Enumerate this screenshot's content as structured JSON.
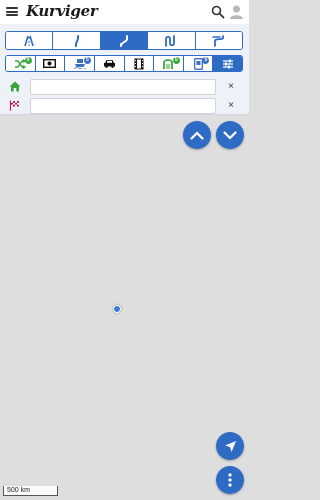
{
  "app": {
    "brand": "Kurviger"
  },
  "header": {
    "menu_icon": "hamburger-menu-icon",
    "search_icon": "search-icon",
    "account_icon": "account-icon"
  },
  "route_types": [
    {
      "icon": "highway-icon",
      "active": false
    },
    {
      "icon": "slight-curvy-road-icon",
      "active": false
    },
    {
      "icon": "curvy-road-icon",
      "active": true
    },
    {
      "icon": "extra-curvy-road-icon",
      "active": false
    },
    {
      "icon": "curvy-fastest-road-icon",
      "active": false
    }
  ],
  "options": [
    {
      "icon": "shuffle-icon",
      "badge": "0",
      "badge_color": "#3aa53a"
    },
    {
      "icon": "toll-icon",
      "badge": ""
    },
    {
      "icon": "ferry-icon",
      "badge": "5",
      "badge_color": "#3a6fc4"
    },
    {
      "icon": "car-icon",
      "badge": ""
    },
    {
      "icon": "film-icon",
      "badge": ""
    },
    {
      "icon": "roadway-icon",
      "badge": "5",
      "badge_color": "#3aa53a"
    },
    {
      "icon": "phone-icon",
      "badge": "5",
      "badge_color": "#3a6fc4"
    },
    {
      "icon": "settings-sliders-icon",
      "badge": "",
      "active": true
    }
  ],
  "locations": {
    "start": {
      "value": "",
      "placeholder": "",
      "clear": "×"
    },
    "destination": {
      "value": "",
      "placeholder": "",
      "clear": "×"
    }
  },
  "map": {
    "scale_label": "500 km"
  },
  "colors": {
    "accent": "#2e6bc4",
    "home_green": "#3aa53a",
    "flag_pink": "#c2185b",
    "map_bg": "#dedede"
  }
}
